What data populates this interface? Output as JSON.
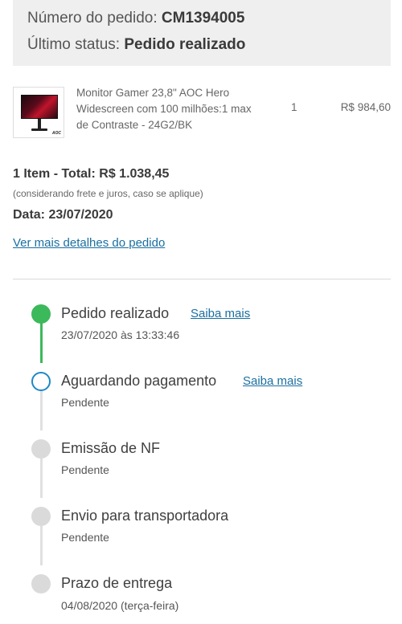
{
  "order": {
    "number_label": "Número do pedido:",
    "number_value": "CM1394005",
    "status_label": "Último status:",
    "status_value": "Pedido realizado"
  },
  "product": {
    "name": "Monitor Gamer 23,8\" AOC Hero Widescreen com 100 milhões:1 max de Contraste - 24G2/BK",
    "quantity": "1",
    "price": "R$ 984,60",
    "thumb_brand": "AOC"
  },
  "summary": {
    "total": "1 Item - Total: R$ 1.038,45",
    "note": "(considerando frete e juros, caso se aplique)",
    "date": "Data: 23/07/2020"
  },
  "details_link": "Ver mais detalhes do pedido",
  "timeline": [
    {
      "title": "Pedido realizado",
      "subtitle": "23/07/2020 às 13:33:46",
      "state": "done",
      "link": "Saiba mais"
    },
    {
      "title": "Aguardando pagamento",
      "subtitle": "Pendente",
      "state": "current",
      "link": "Saiba mais"
    },
    {
      "title": "Emissão de NF",
      "subtitle": "Pendente",
      "state": "pending"
    },
    {
      "title": "Envio para transportadora",
      "subtitle": "Pendente",
      "state": "pending"
    },
    {
      "title": "Prazo de entrega",
      "subtitle": "04/08/2020 (terça-feira)",
      "state": "pending"
    }
  ],
  "colors": {
    "done": "#3cb95b",
    "current": "#1e88c7",
    "pending": "#dadada",
    "link": "#1a6fa0"
  }
}
